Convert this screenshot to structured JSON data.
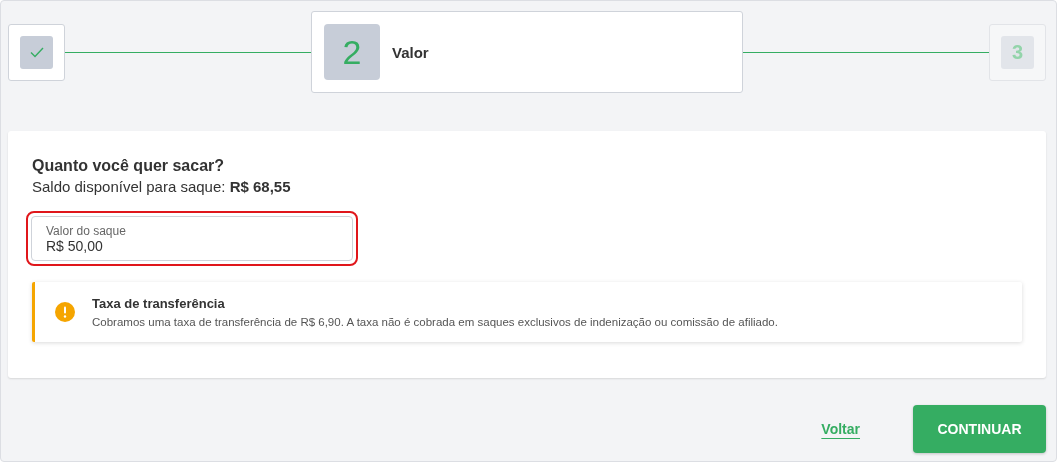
{
  "steps": [
    {
      "kind": "done"
    },
    {
      "number": "2",
      "label": "Valor",
      "kind": "current"
    },
    {
      "number": "3",
      "kind": "upcoming"
    }
  ],
  "question": "Quanto você quer sacar?",
  "balance": "Saldo disponível para saque: **R$ 68,55**",
  "amount_field": {
    "label": "Valor do saque",
    "value": "R$ 50,00",
    "error": true
  },
  "notice": {
    "title": "Taxa de transferência",
    "text": "Cobramos uma taxa de transferência de R$ 6,90. A taxa não é cobrada em saques exclusivos de indenização ou comissão de afiliado."
  },
  "back_link": "Voltar",
  "continue_button": "CONTINUAR"
}
